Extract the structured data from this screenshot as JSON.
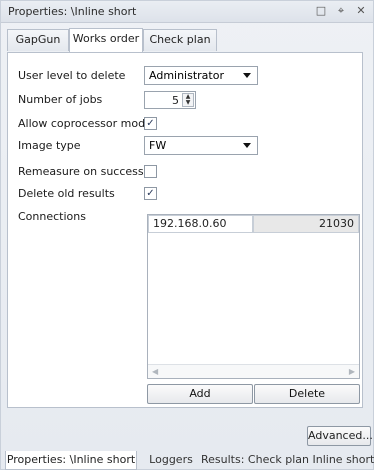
{
  "window": {
    "title": "Properties: \\Inline short",
    "pin_glyph": "⌖",
    "float_glyph": "□",
    "close_glyph": "✕"
  },
  "tabs": [
    {
      "label": "GapGun"
    },
    {
      "label": "Works order"
    },
    {
      "label": "Check plan"
    }
  ],
  "form": {
    "user_level_label": "User level to delete",
    "user_level_value": "Administrator",
    "num_jobs_label": "Number of jobs",
    "num_jobs_value": "5",
    "allow_coprocessor_label": "Allow coprocessor mode",
    "allow_coprocessor_checked": "✓",
    "image_type_label": "Image type",
    "image_type_value": "FW",
    "remeasure_label": "Remeasure on success",
    "remeasure_checked": "",
    "delete_old_label": "Delete old results",
    "delete_old_checked": "✓",
    "connections_label": "Connections"
  },
  "connections": [
    {
      "ip": "192.168.0.60",
      "port": "21030"
    }
  ],
  "buttons": {
    "add": "Add",
    "delete": "Delete",
    "advanced": "Advanced..."
  },
  "bottom_tabs": [
    {
      "label": "Properties: \\Inline short"
    },
    {
      "label": "Loggers"
    },
    {
      "label": "Results: Check plan Inline short"
    }
  ]
}
